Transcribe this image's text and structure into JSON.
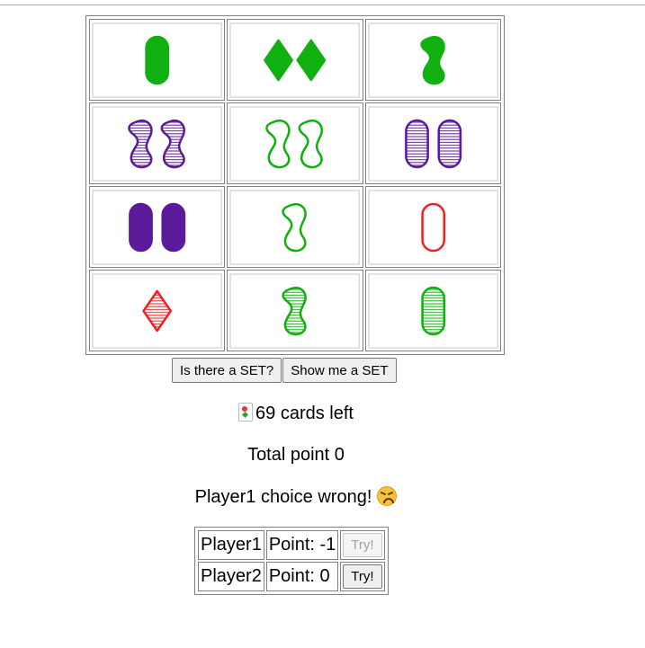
{
  "board": {
    "cards": [
      {
        "count": 1,
        "shape": "oval",
        "color": "#10b010",
        "fill": "solid"
      },
      {
        "count": 2,
        "shape": "diamond",
        "color": "#10b010",
        "fill": "solid"
      },
      {
        "count": 1,
        "shape": "squiggle",
        "color": "#10b010",
        "fill": "solid"
      },
      {
        "count": 2,
        "shape": "squiggle",
        "color": "#5a1a9a",
        "fill": "striped"
      },
      {
        "count": 2,
        "shape": "squiggle",
        "color": "#10b010",
        "fill": "empty"
      },
      {
        "count": 2,
        "shape": "oval",
        "color": "#5a1a9a",
        "fill": "striped"
      },
      {
        "count": 2,
        "shape": "oval",
        "color": "#5a1a9a",
        "fill": "solid"
      },
      {
        "count": 1,
        "shape": "squiggle",
        "color": "#10b010",
        "fill": "empty"
      },
      {
        "count": 1,
        "shape": "oval",
        "color": "#ee2222",
        "fill": "empty"
      },
      {
        "count": 1,
        "shape": "diamond",
        "color": "#ee2222",
        "fill": "striped"
      },
      {
        "count": 1,
        "shape": "squiggle",
        "color": "#10b010",
        "fill": "striped"
      },
      {
        "count": 1,
        "shape": "oval",
        "color": "#10b010",
        "fill": "striped"
      }
    ]
  },
  "controls": {
    "is_there_set_label": "Is there a SET?",
    "show_set_label": "Show me a SET"
  },
  "status": {
    "deck_icon": "playing-card-icon",
    "cards_left": "69 cards left",
    "total_point": "Total point 0",
    "message": "Player1 choice wrong!",
    "message_icon": "confounded-face-icon"
  },
  "players": [
    {
      "name": "Player1",
      "points": "Point: -1",
      "try_label": "Try!",
      "try_enabled": false
    },
    {
      "name": "Player2",
      "points": "Point: 0",
      "try_label": "Try!",
      "try_enabled": true
    }
  ]
}
